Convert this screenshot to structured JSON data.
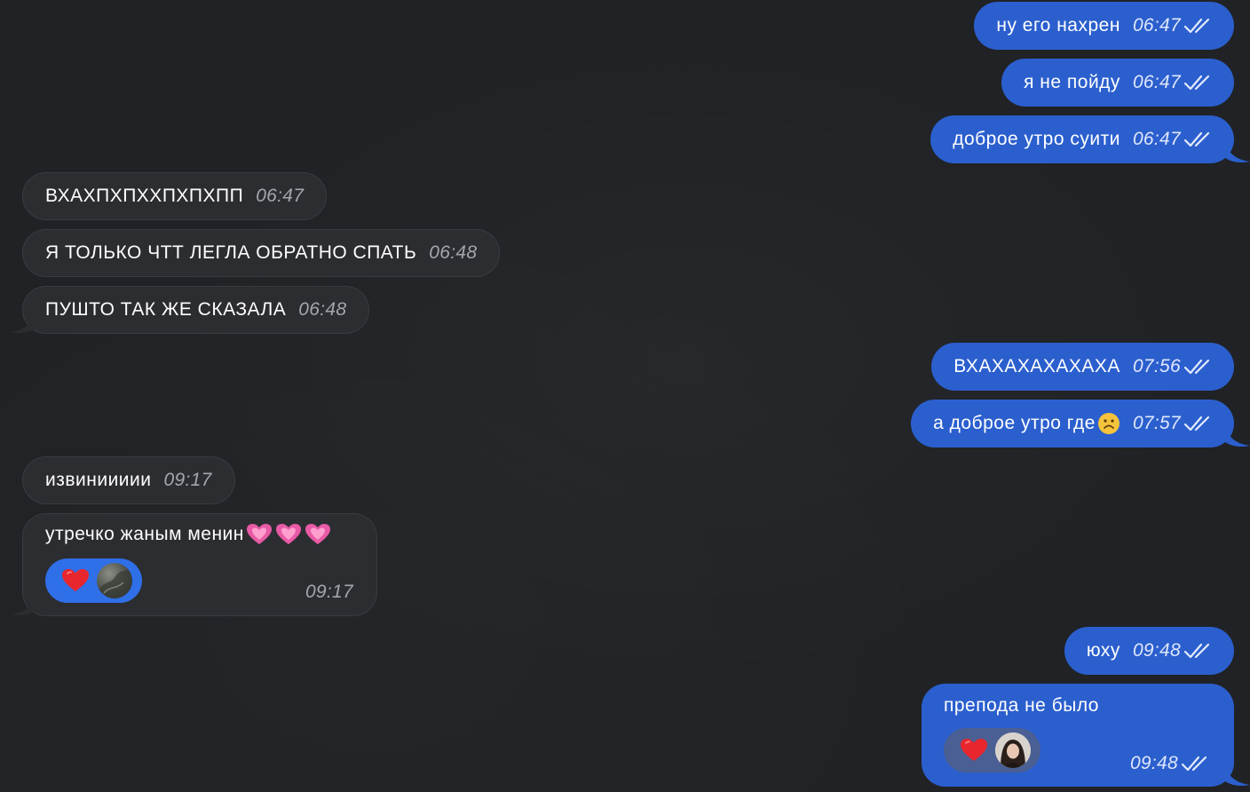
{
  "colors": {
    "background": "#212326",
    "outgoing_bubble": "#2b5fce",
    "incoming_bubble": "#2c2d31",
    "reaction_outgoing_pill": "#3a6fe0",
    "reaction_incoming_pill": "#4a5a82"
  },
  "messages": [
    {
      "id": "m1",
      "direction": "outgoing",
      "text": "ну его нахрен",
      "time": "06:47",
      "status": "read-double-check-icon"
    },
    {
      "id": "m2",
      "direction": "outgoing",
      "text": "я не пойду",
      "time": "06:47",
      "status": "read-double-check-icon"
    },
    {
      "id": "m3",
      "direction": "outgoing",
      "text": "доброе утро суити",
      "time": "06:47",
      "status": "read-double-check-icon"
    },
    {
      "id": "m4",
      "direction": "incoming",
      "text": "ВХАХПХПХХПХПХПП",
      "time": "06:47"
    },
    {
      "id": "m5",
      "direction": "incoming",
      "text": "Я ТОЛЬКО ЧТТ ЛЕГЛА ОБРАТНО СПАТЬ",
      "time": "06:48"
    },
    {
      "id": "m6",
      "direction": "incoming",
      "text": "ПУШТО ТАК ЖЕ СКАЗАЛА",
      "time": "06:48"
    },
    {
      "id": "m7",
      "direction": "outgoing",
      "text": "ВХАХАХАХАХАХА",
      "time": "07:56",
      "status": "read-double-check-icon"
    },
    {
      "id": "m8",
      "direction": "outgoing",
      "text": "а доброе утро где",
      "emoji": "frowning-face-emoji",
      "time": "07:57",
      "status": "read-double-check-icon"
    },
    {
      "id": "m9",
      "direction": "incoming",
      "text": "извиниииии",
      "time": "09:17"
    },
    {
      "id": "m10",
      "direction": "incoming",
      "text": "утречко жаным менин",
      "emoji": "pink-heart-emoji x3",
      "time": "09:17",
      "reaction": "red-heart-emoji"
    },
    {
      "id": "m11",
      "direction": "outgoing",
      "text": "юху",
      "time": "09:48",
      "status": "read-double-check-icon"
    },
    {
      "id": "m12",
      "direction": "outgoing",
      "text": "препода не было",
      "time": "09:48",
      "status": "read-double-check-icon",
      "reaction": "red-heart-emoji"
    }
  ]
}
